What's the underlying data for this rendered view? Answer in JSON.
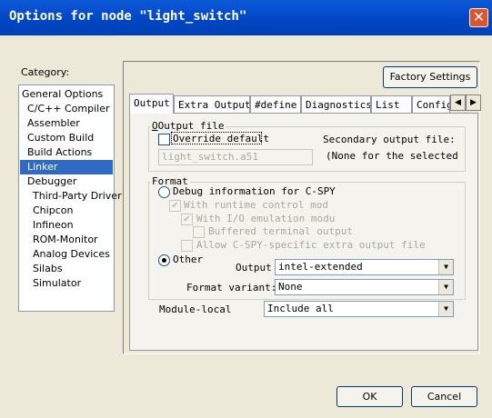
{
  "window": {
    "title": "Options for node \"light_switch\"",
    "close_label": "✕"
  },
  "category": {
    "label": "Category:",
    "items": [
      {
        "label": "General Options",
        "indent": 0,
        "selected": false
      },
      {
        "label": "C/C++ Compiler",
        "indent": 1,
        "selected": false
      },
      {
        "label": "Assembler",
        "indent": 1,
        "selected": false
      },
      {
        "label": "Custom Build",
        "indent": 1,
        "selected": false
      },
      {
        "label": "Build Actions",
        "indent": 1,
        "selected": false
      },
      {
        "label": "Linker",
        "indent": 1,
        "selected": true
      },
      {
        "label": "Debugger",
        "indent": 1,
        "selected": false
      },
      {
        "label": "Third-Party Driver",
        "indent": 2,
        "selected": false
      },
      {
        "label": "Chipcon",
        "indent": 2,
        "selected": false
      },
      {
        "label": "Infineon",
        "indent": 2,
        "selected": false
      },
      {
        "label": "ROM-Monitor",
        "indent": 2,
        "selected": false
      },
      {
        "label": "Analog Devices",
        "indent": 2,
        "selected": false
      },
      {
        "label": "Silabs",
        "indent": 2,
        "selected": false
      },
      {
        "label": "Simulator",
        "indent": 2,
        "selected": false
      }
    ]
  },
  "factory_settings_label": "Factory Settings",
  "tabs": [
    {
      "label": "Output",
      "active": true
    },
    {
      "label": "Extra Output",
      "active": false
    },
    {
      "label": "#define",
      "active": false
    },
    {
      "label": "Diagnostics",
      "active": false
    },
    {
      "label": "List",
      "active": false
    },
    {
      "label": "Config",
      "active": false
    }
  ],
  "tab_scroll": {
    "left": "◀",
    "right": "▶"
  },
  "output_file": {
    "legend": "Output file",
    "override_label": "Override default",
    "override_checked": false,
    "filename": "light_switch.a51",
    "secondary_label": "Secondary output file:",
    "secondary_value": "(None for the selected fo"
  },
  "format": {
    "legend": "Format",
    "debug_label": "Debug information for C-SPY",
    "runtime_label": "With runtime control mod",
    "io_label": "With I/O emulation modu",
    "buffered_label": "Buffered terminal output",
    "allow_label": "Allow C-SPY-specific extra output file",
    "other_label": "Other",
    "output_label": "Output",
    "output_value": "intel-extended",
    "variant_label": "Format variant:",
    "variant_value": "None",
    "selected": "other"
  },
  "module_local": {
    "label": "Module-local",
    "value": "Include all"
  },
  "buttons": {
    "ok": "OK",
    "cancel": "Cancel"
  },
  "check_glyph": "✔"
}
